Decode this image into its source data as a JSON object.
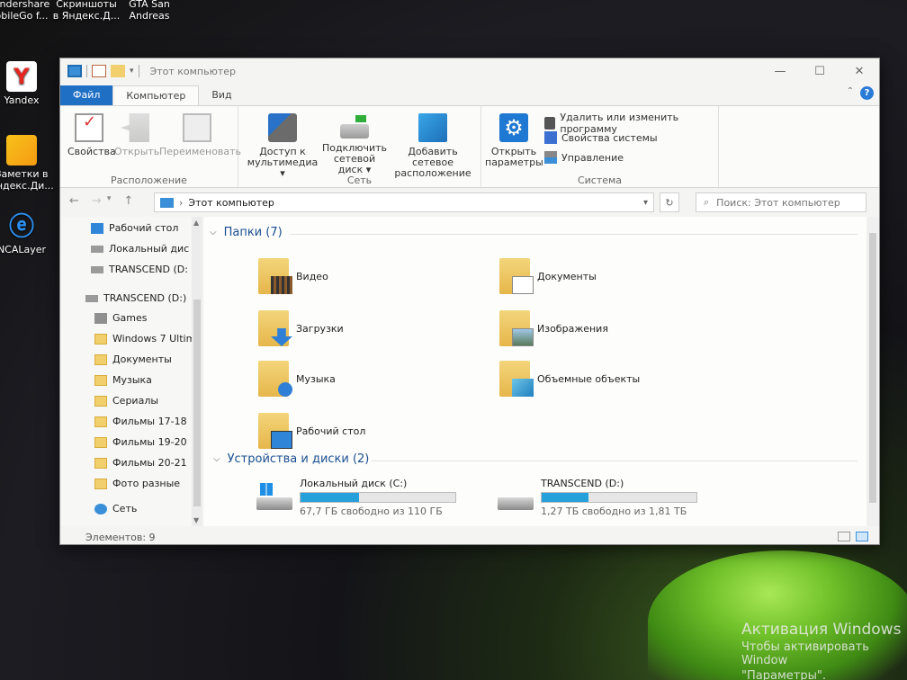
{
  "desktop": {
    "icons": [
      {
        "label_1": "ondershare",
        "label_2": "obileGo f..."
      },
      {
        "label_1": "Скриншоты",
        "label_2": "в Яндекс.Д..."
      },
      {
        "label_1": "GTA San",
        "label_2": "Andreas"
      },
      {
        "label_1": "Yandex"
      },
      {
        "label_1": "Заметки в",
        "label_2": "Яндекс.Ди..."
      },
      {
        "label_1": "NCALayer"
      }
    ],
    "activation": {
      "title": "Активация Windows",
      "line1": "Чтобы активировать Window",
      "line2": "\"Параметры\"."
    }
  },
  "window": {
    "title": "Этот компьютер",
    "tabs": [
      "Файл",
      "Компьютер",
      "Вид"
    ],
    "ribbon": {
      "location": {
        "label": "Расположение",
        "properties": "Свойства",
        "open": "Открыть",
        "rename": "Переименовать"
      },
      "network": {
        "label": "Сеть",
        "media_1": "Доступ к",
        "media_2": "мультимедиа ▾",
        "map_1": "Подключить",
        "map_2": "сетевой диск ▾",
        "add_1": "Добавить сетевое",
        "add_2": "расположение"
      },
      "system": {
        "label": "Система",
        "settings_1": "Открыть",
        "settings_2": "параметры",
        "uninstall": "Удалить или изменить программу",
        "sysprops": "Свойства системы",
        "manage": "Управление"
      }
    },
    "address": {
      "path": "Этот компьютер",
      "search_placeholder": "Поиск: Этот компьютер"
    },
    "nav": {
      "quick": [
        "Рабочий стол",
        "Локальный дис",
        "TRANSCEND (D:"
      ],
      "drive_root": "TRANSCEND (D:)",
      "drive_children": [
        "Games",
        "Windows 7 Ultim",
        "Документы",
        "Музыка",
        "Сериалы",
        "Фильмы 17-18",
        "Фильмы 19-20",
        "Фильмы 20-21",
        "Фото разные"
      ],
      "network": "Сеть"
    },
    "folders_header": "Папки (7)",
    "folders": [
      "Видео",
      "Документы",
      "Загрузки",
      "Изображения",
      "Музыка",
      "Объемные объекты",
      "Рабочий стол"
    ],
    "devices_header": "Устройства и диски (2)",
    "drives": [
      {
        "name": "Локальный диск (C:)",
        "free": "67,7 ГБ свободно из 110 ГБ",
        "used_fraction": 0.38
      },
      {
        "name": "TRANSCEND (D:)",
        "free": "1,27 ТБ свободно из 1,81 ТБ",
        "used_fraction": 0.3
      }
    ],
    "status": "Элементов: 9"
  }
}
